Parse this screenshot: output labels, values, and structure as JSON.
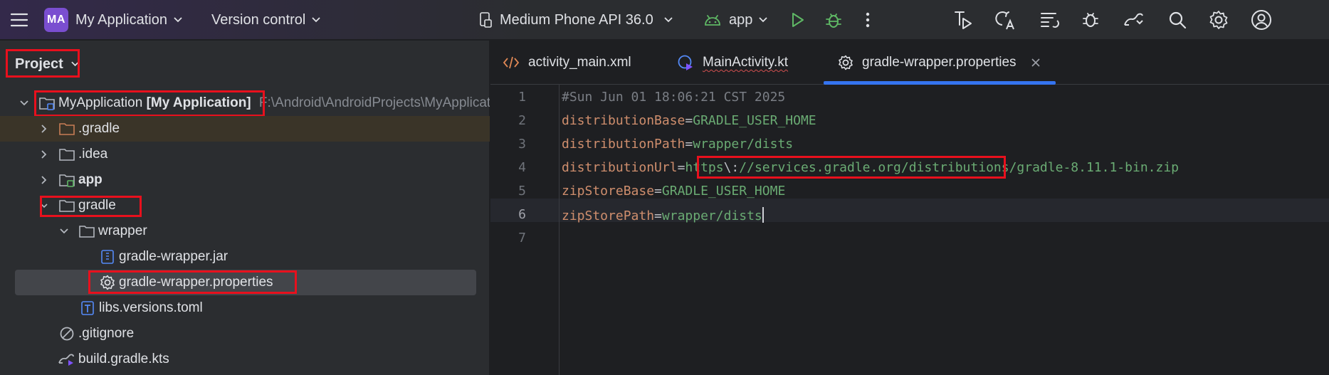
{
  "toolbar": {
    "project_initials": "MA",
    "project_name": "My Application",
    "vcs_label": "Version control",
    "device_label": "Medium Phone API 36.0",
    "run_config": "app",
    "icons": [
      "hamburger-menu-icon",
      "chevron-down-icon",
      "device-icon",
      "android-icon",
      "run-icon",
      "debug-icon",
      "more-vert-icon",
      "build-run-icon",
      "translate-icon",
      "commit-icon",
      "profiler-icon",
      "sync-icon",
      "search-icon",
      "settings-icon",
      "account-icon"
    ],
    "colors": {
      "accent": "#7a4ed0",
      "run": "#5fb865",
      "debug": "#5fb865"
    }
  },
  "project_panel": {
    "title": "Project",
    "tree": [
      {
        "label": "MyApplication",
        "label_bold": "[My Application]",
        "path": "F:\\Android\\AndroidProjects\\MyApplication",
        "icon": "module-folder-icon",
        "expanded": true
      },
      {
        "label": ".gradle",
        "icon": "folder-orange-icon",
        "expanded": false
      },
      {
        "label": ".idea",
        "icon": "folder-icon",
        "expanded": false
      },
      {
        "label": "app",
        "icon": "module-folder-icon",
        "expanded": false
      },
      {
        "label": "gradle",
        "icon": "folder-icon",
        "expanded": true
      },
      {
        "label": "wrapper",
        "icon": "folder-icon",
        "expanded": true
      },
      {
        "label": "gradle-wrapper.jar",
        "icon": "jar-file-icon"
      },
      {
        "label": "gradle-wrapper.properties",
        "icon": "properties-file-icon",
        "selected": true
      },
      {
        "label": "libs.versions.toml",
        "icon": "toml-file-icon"
      },
      {
        "label": ".gitignore",
        "icon": "gitignore-file-icon"
      },
      {
        "label": "build.gradle.kts",
        "icon": "gradle-kts-file-icon"
      }
    ]
  },
  "editor": {
    "tabs": [
      {
        "label": "activity_main.xml",
        "icon": "xml-icon"
      },
      {
        "label": "MainActivity.kt",
        "icon": "kotlin-activity-icon"
      },
      {
        "label": "gradle-wrapper.properties",
        "icon": "settings-file-icon",
        "active": true
      }
    ],
    "line_numbers": [
      "1",
      "2",
      "3",
      "4",
      "5",
      "6",
      "7"
    ],
    "lines": {
      "l1": "#Sun Jun 01 18:06:21 CST 2025",
      "l2_key": "distributionBase",
      "l2_val": "GRADLE_USER_HOME",
      "l3_key": "distributionPath",
      "l3_val": "wrapper/dists",
      "l4_key": "distributionUrl",
      "l4_val_a": "https",
      "l4_val_esc": "\\:",
      "l4_val_b": "//services.gradle.org/distributions/",
      "l4_val_c": "gradle-8.11.1-bin.zip",
      "l5_key": "zipStoreBase",
      "l5_val": "GRADLE_USER_HOME",
      "l6_key": "zipStorePath",
      "l6_val": "wrapper/dists"
    },
    "equals": "="
  }
}
